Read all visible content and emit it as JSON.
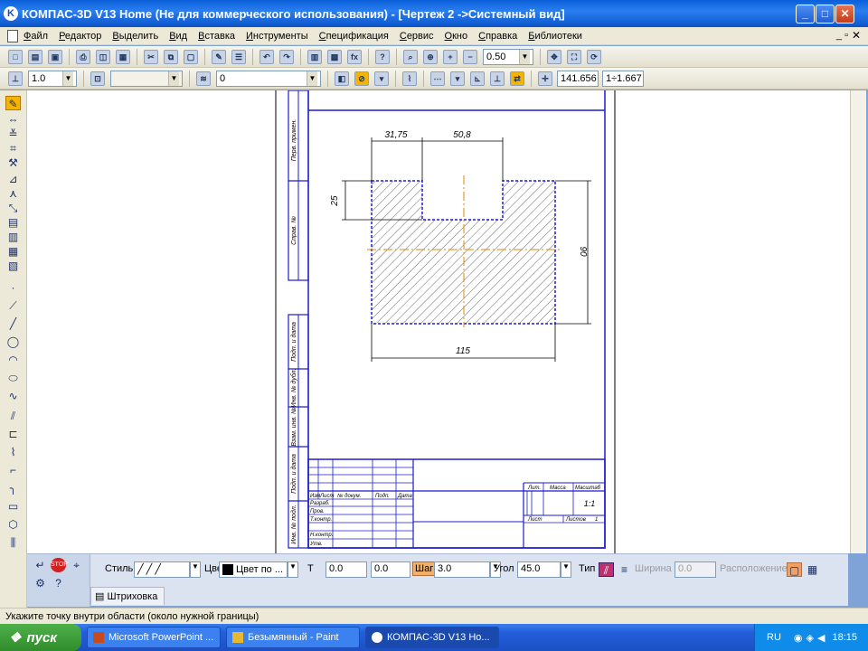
{
  "window": {
    "title": "КОМПАС-3D V13 Home (Не для коммерческого использования) - [Чертеж 2 ->Системный вид]",
    "controls": [
      "minimize",
      "maximize",
      "close"
    ]
  },
  "menu": {
    "items": [
      "Файл",
      "Редактор",
      "Выделить",
      "Вид",
      "Вставка",
      "Инструменты",
      "Спецификация",
      "Сервис",
      "Окно",
      "Справка",
      "Библиотеки"
    ]
  },
  "toolbar1": {
    "zoom_value": "0.50"
  },
  "toolbar2": {
    "scale_value": "1.0",
    "style_value": "",
    "layer_value": "0",
    "coord_x": "141.656",
    "coord_y": "1÷1.667"
  },
  "drawing": {
    "dim_top_left": "31,75",
    "dim_top_right": "50,8",
    "dim_left": "25",
    "dim_right": "90",
    "dim_bottom": "115",
    "frame_labels": [
      "Перв. примен.",
      "Справ. №",
      "Подп. и дата",
      "Инв. № дубл.",
      "Взам. инв. №",
      "Подп. и дата",
      "Инв. № подл."
    ],
    "tb_left_header": [
      "Изм",
      "Лист",
      "№ докум.",
      "Подп.",
      "Дата"
    ],
    "tb_left_rows": [
      "Разраб.",
      "Пров.",
      "Т.контр.",
      "",
      "Н.контр.",
      "Утв."
    ],
    "tb_right_header": [
      "Лит.",
      "Масса",
      "Масштаб"
    ],
    "tb_scale": "1:1",
    "tb_sheet_label": "Лист",
    "tb_sheets_label": "Листов",
    "tb_sheets_value": "1"
  },
  "panel": {
    "style_label": "Стиль",
    "color_label": "Цвет",
    "color_value": "Цвет по ...",
    "t_label": "Т",
    "t_value": "0.0",
    "t_value2": "0.0",
    "step_label": "Шаг",
    "step_value": "3.0",
    "angle_label": "Угол",
    "angle_value": "45.0",
    "type_label": "Тип",
    "width_label": "Ширина",
    "width_value": "0.0",
    "position_label": "Расположение",
    "tab_label": "Штриховка"
  },
  "status": {
    "text": "Укажите точку внутри области (около нужной границы)"
  },
  "taskbar": {
    "start_label": "пуск",
    "tasks": [
      "Microsoft PowerPoint ...",
      "Безымянный - Paint",
      "КОМПАС-3D V13 Ho..."
    ],
    "lang": "RU",
    "clock": "18:15"
  },
  "colors": {
    "titlebar": "#0a5fd8",
    "hatch": "#2a2a2a",
    "axis": "#e08a00",
    "dimension": "#000000",
    "frame": "#1b1bd0",
    "selection": "#1b1bd0"
  }
}
